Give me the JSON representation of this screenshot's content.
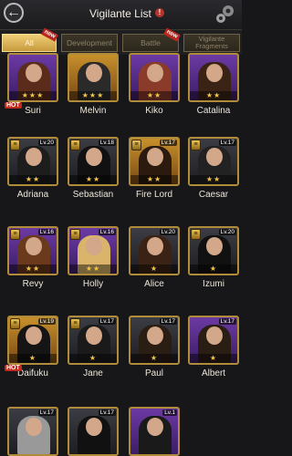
{
  "header": {
    "title": "Vigilante List",
    "info_symbol": "!"
  },
  "tabs": [
    {
      "label": "All",
      "active": true,
      "new": true
    },
    {
      "label": "Development",
      "active": false,
      "new": false
    },
    {
      "label": "Battle",
      "active": false,
      "new": true
    },
    {
      "label": "Vigilante Fragments",
      "active": false,
      "new": false
    }
  ],
  "new_tag": "new",
  "hot_tag": "HOT",
  "vigilantes": [
    {
      "name": "Suri",
      "stars": "★★★",
      "level": "",
      "hot": true
    },
    {
      "name": "Melvin",
      "stars": "★★★",
      "level": ""
    },
    {
      "name": "Kiko",
      "stars": "★★",
      "level": ""
    },
    {
      "name": "Catalina",
      "stars": "★★",
      "level": ""
    },
    {
      "name": "Adriana",
      "stars": "★★",
      "level": "Lv.20"
    },
    {
      "name": "Sebastian",
      "stars": "★★",
      "level": "Lv.18"
    },
    {
      "name": "Fire Lord",
      "stars": "★★",
      "level": "Lv.17"
    },
    {
      "name": "Caesar",
      "stars": "★★",
      "level": "Lv.17"
    },
    {
      "name": "Revy",
      "stars": "★★",
      "level": "Lv.16"
    },
    {
      "name": "Holly",
      "stars": "★★",
      "level": "Lv.16"
    },
    {
      "name": "Alice",
      "stars": "★",
      "level": "Lv.20"
    },
    {
      "name": "Izumi",
      "stars": "★",
      "level": "Lv.20"
    },
    {
      "name": "Daifuku",
      "stars": "★",
      "level": "Lv.19",
      "hot": true
    },
    {
      "name": "Jane",
      "stars": "★",
      "level": "Lv.17"
    },
    {
      "name": "Paul",
      "stars": "★",
      "level": "Lv.17"
    },
    {
      "name": "Albert",
      "stars": "★",
      "level": "Lv.17"
    },
    {
      "name": "",
      "stars": "",
      "level": "Lv.17"
    },
    {
      "name": "",
      "stars": "",
      "level": "Lv.17"
    },
    {
      "name": "",
      "stars": "",
      "level": "Lv.1"
    }
  ],
  "colors": {
    "gold_border": "#b08b39",
    "purple": "#6c3aa4",
    "gold": "#c8902c",
    "star": "#f0c54a",
    "hot": "#c42a1e"
  }
}
